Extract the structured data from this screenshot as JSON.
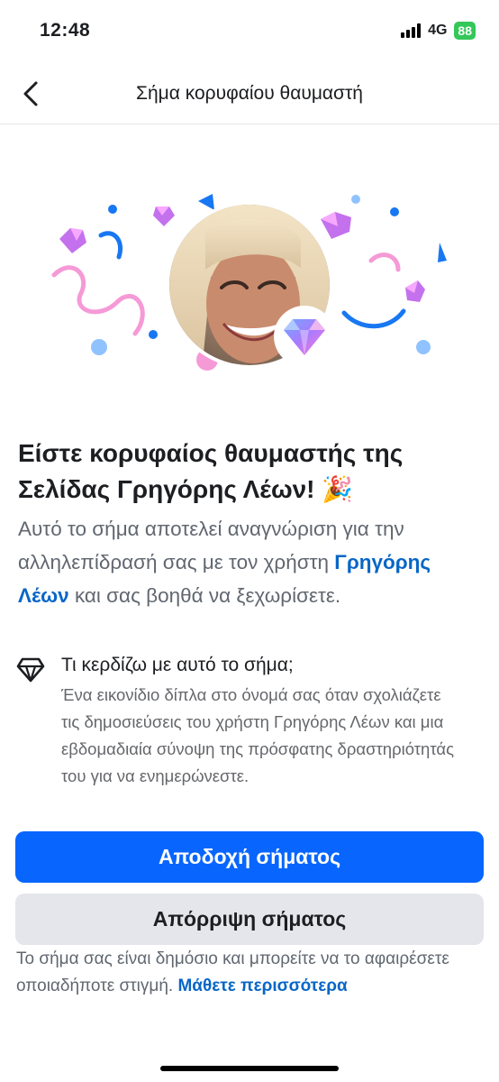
{
  "status_bar": {
    "time": "12:48",
    "network": "4G",
    "battery": "88"
  },
  "header": {
    "title": "Σήμα κορυφαίου θαυμαστή",
    "back_icon": "chevron-left-icon"
  },
  "hero": {
    "avatar_alt": "profile-photo",
    "badge_icon": "diamond-icon"
  },
  "headline": {
    "text": "Είστε κορυφαίος θαυμαστής της Σελίδας Γρηγόρης Λέων!",
    "emoji": "🎉"
  },
  "description": {
    "part1": "Αυτό το σήμα αποτελεί αναγνώριση για την αλληλεπίδρασή σας με τον χρήστη ",
    "name_link": "Γρηγόρης Λέων",
    "part2": " και σας βοηθά να ξεχωρίσετε."
  },
  "benefit": {
    "icon": "diamond-outline-icon",
    "title": "Τι κερδίζω με αυτό το σήμα;",
    "text": "Ένα εικονίδιο δίπλα στο όνομά σας όταν σχολιάζετε τις δημοσιεύσεις του χρήστη Γρηγόρης Λέων και μια εβδομαδιαία σύνοψη της πρόσφατης δραστηριότητάς του για να ενημερώνεστε."
  },
  "buttons": {
    "accept": "Αποδοχή σήματος",
    "reject": "Απόρριψη σήματος"
  },
  "footer": {
    "text": "Το σήμα σας είναι δημόσιο και μπορείτε να το αφαιρέσετε οποιαδήποτε στιγμή. ",
    "link": "Μάθετε περισσότερα"
  },
  "colors": {
    "accent": "#0866ff",
    "link": "#0866c6",
    "secondary_button": "#e4e6eb"
  }
}
